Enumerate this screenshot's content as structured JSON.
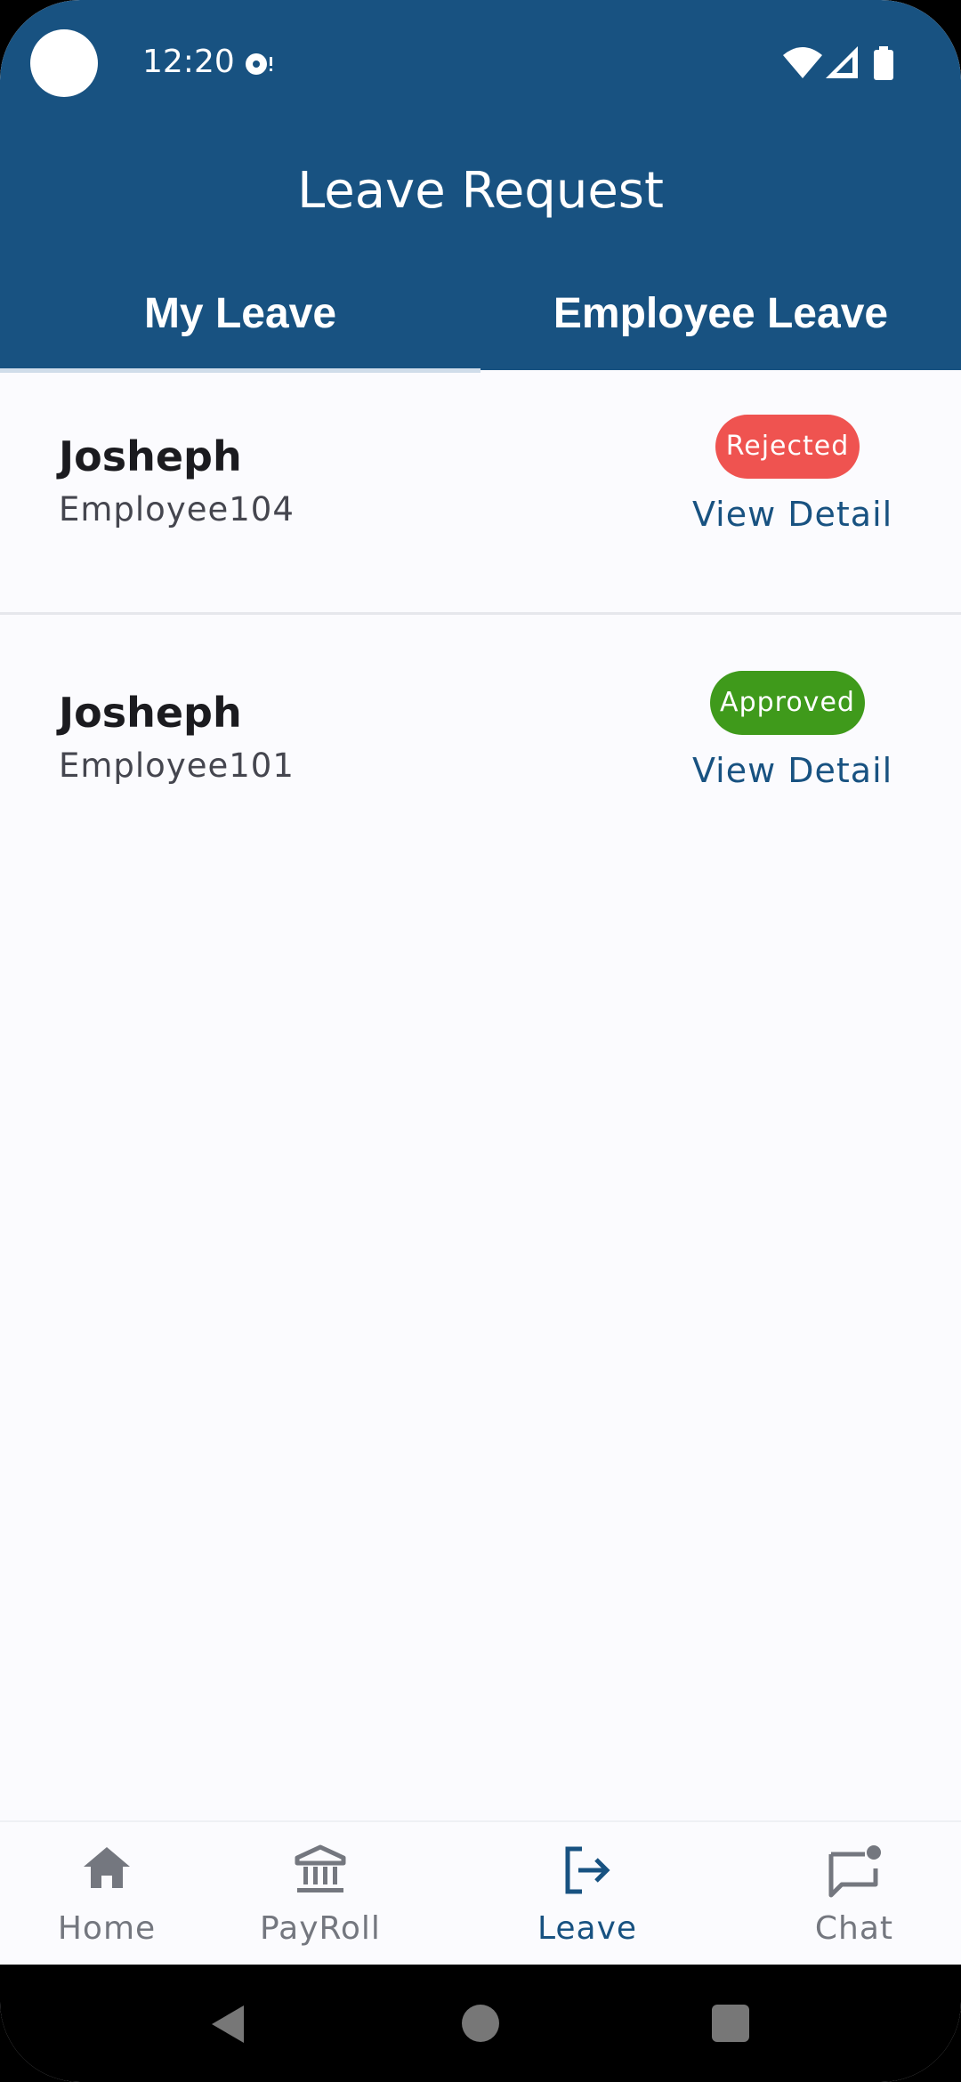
{
  "status_bar": {
    "time": "12:20"
  },
  "appbar": {
    "title": "Leave Request"
  },
  "tabs": [
    {
      "label": "My Leave",
      "selected": true
    },
    {
      "label": "Employee Leave",
      "selected": false
    }
  ],
  "leave_list": [
    {
      "name": "Josheph",
      "employee_id": "Employee104",
      "status": "Rejected",
      "status_color": "#EF5350",
      "action": "View Detail"
    },
    {
      "name": "Josheph",
      "employee_id": "Employee101",
      "status": "Approved",
      "status_color": "#3F9A1B",
      "action": "View Detail"
    }
  ],
  "bottom_nav": [
    {
      "label": "Home",
      "icon": "home-icon"
    },
    {
      "label": "PayRoll",
      "icon": "bank-icon"
    },
    {
      "label": "Leave",
      "icon": "logout-arrow-icon",
      "active": true
    },
    {
      "label": "Chat",
      "icon": "chat-icon"
    }
  ],
  "colors": {
    "primary": "#185281",
    "rejected": "#EF5350",
    "approved": "#3F9A1B"
  }
}
